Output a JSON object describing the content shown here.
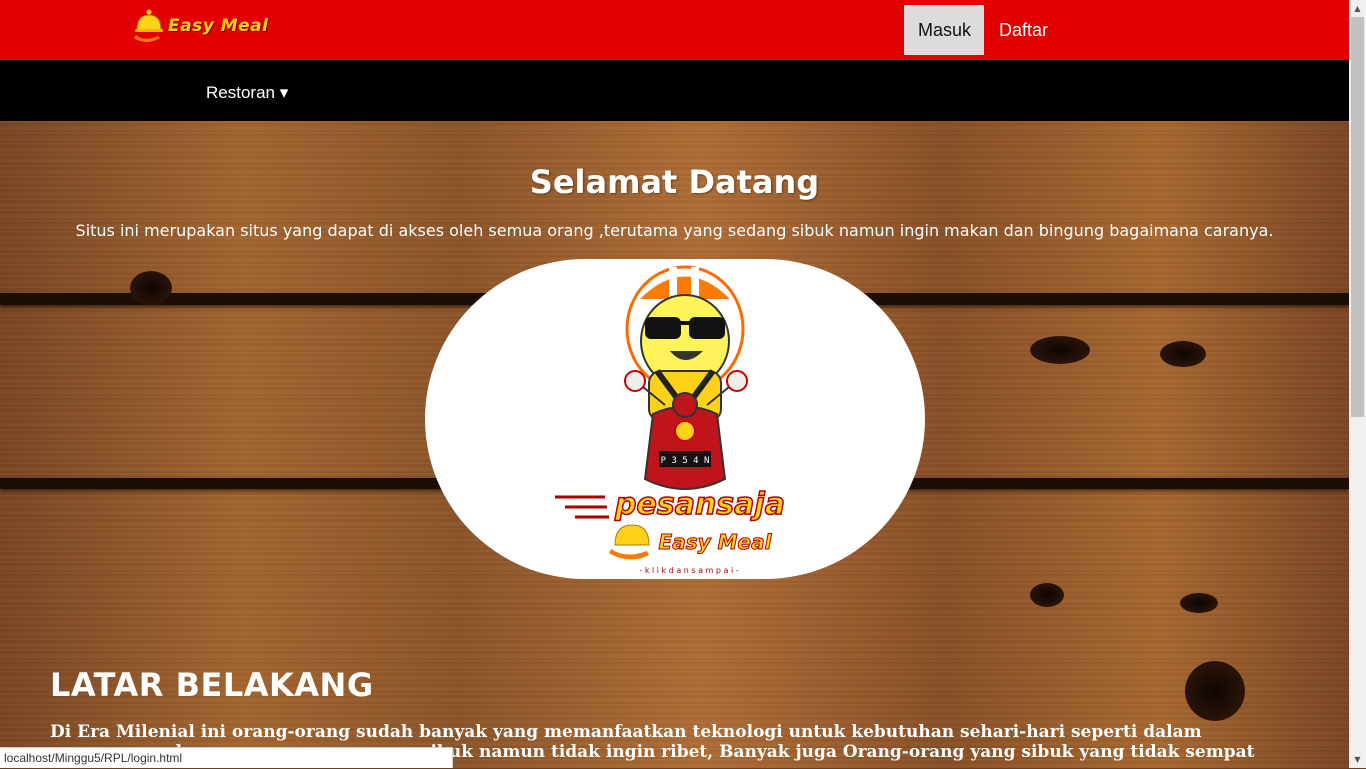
{
  "header": {
    "brand": "Easy Meal",
    "login_label": "Masuk",
    "register_label": "Daftar"
  },
  "subnav": {
    "restaurant_label": "Restoran ▾"
  },
  "hero": {
    "title": "Selamat Datang",
    "description": "Situs ini merupakan situs yang dapat di akses oleh semua orang ,terutama yang sedang sibuk namun ingin makan dan bingung bagaimana caranya.",
    "logo": {
      "tagline": "pesansaja",
      "brand": "Easy Meal",
      "slogan": "- k l i k   d a n   s a m p a i -",
      "plate": "P 3 5 4 N"
    }
  },
  "background_section": {
    "title": "LATAR BELAKANG",
    "text": "Di Era Milenial ini orang-orang sudah banyak yang memanfaatkan teknologi untuk kebutuhan sehari-hari seperti dalam memesan makanan, orang-orang yang sibuk namun tidak ingin ribet, Banyak juga Orang-orang yang sibuk yang tidak sempat keluar untuk membeli"
  },
  "status_bar": {
    "url": "localhost/Minggu5/RPL/login.html"
  },
  "colors": {
    "header_red": "#e30000",
    "nav_black": "#000000",
    "brand_yellow": "#ffd21a"
  }
}
